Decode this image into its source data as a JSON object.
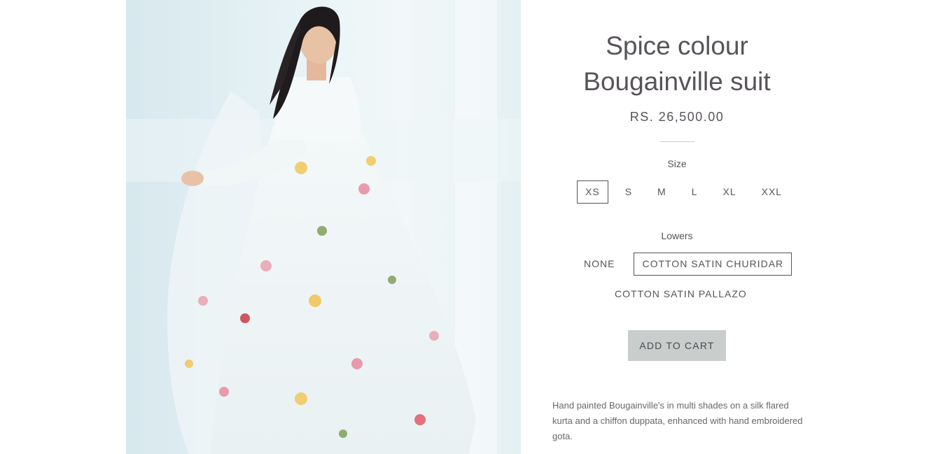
{
  "product": {
    "title_line1": "Spice colour",
    "title_line2": "Bougainville suit",
    "price": "RS. 26,500.00",
    "size_label": "Size",
    "sizes": [
      "XS",
      "S",
      "M",
      "L",
      "XL",
      "XXL"
    ],
    "selected_size": "XS",
    "lowers_label": "Lowers",
    "lowers": [
      "NONE",
      "COTTON SATIN CHURIDAR",
      "COTTON SATIN PALLAZO"
    ],
    "selected_lowers": "COTTON SATIN CHURIDAR",
    "add_to_cart_label": "ADD TO CART",
    "description": "Hand painted Bougainville's in multi shades on a silk flared kurta and a chiffon duppata, enhanced with hand embroidered gota."
  },
  "colors": {
    "text": "#58535a",
    "button_bg": "#c9cdcc",
    "photo_bg": "#e6f2f5"
  }
}
